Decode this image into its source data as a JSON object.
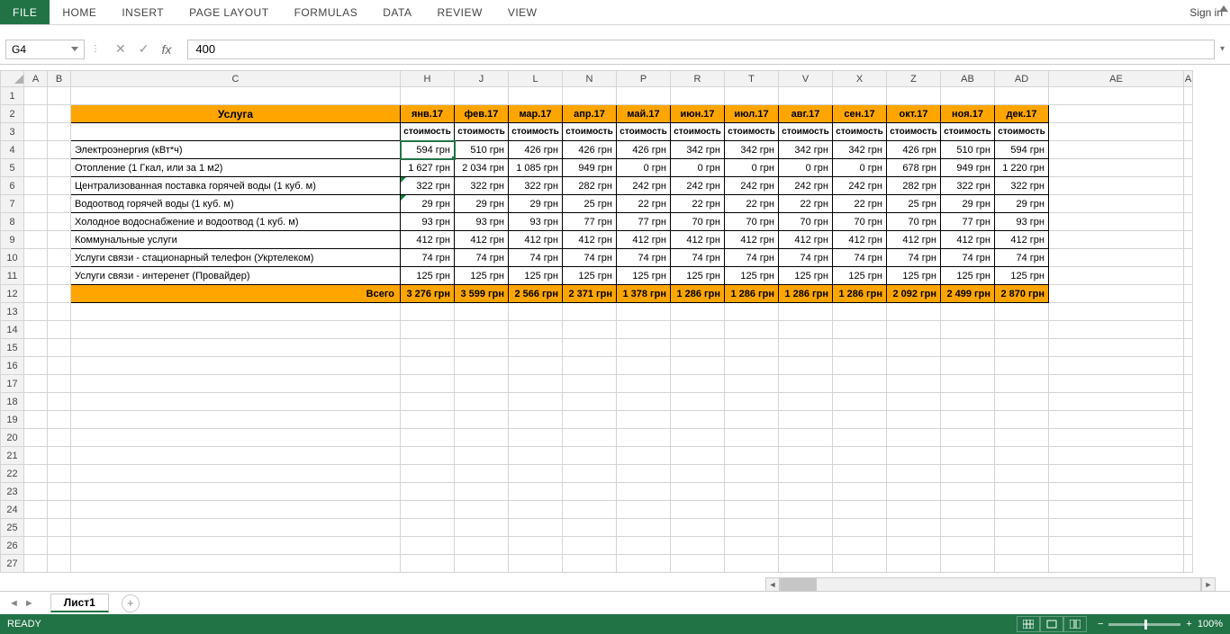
{
  "ribbon": {
    "file": "FILE",
    "tabs": [
      "HOME",
      "INSERT",
      "PAGE LAYOUT",
      "FORMULAS",
      "DATA",
      "REVIEW",
      "VIEW"
    ],
    "signin": "Sign in"
  },
  "fx": {
    "namebox": "G4",
    "formula": "400"
  },
  "columns": [
    "A",
    "B",
    "C",
    "H",
    "J",
    "L",
    "N",
    "P",
    "R",
    "T",
    "V",
    "X",
    "Z",
    "AB",
    "AD",
    "AE",
    "A"
  ],
  "table": {
    "service_header": "Услуга",
    "months": [
      "янв.17",
      "фев.17",
      "мар.17",
      "апр.17",
      "май.17",
      "июн.17",
      "июл.17",
      "авг.17",
      "сен.17",
      "окт.17",
      "ноя.17",
      "дек.17"
    ],
    "subheader": "стоимость",
    "rows": [
      {
        "name": "Электроэнергия (кВт*ч)",
        "vals": [
          "594 грн",
          "510 грн",
          "426 грн",
          "426 грн",
          "426 грн",
          "342 грн",
          "342 грн",
          "342 грн",
          "342 грн",
          "426 грн",
          "510 грн",
          "594 грн"
        ]
      },
      {
        "name": "Отопление (1 Гкал, или за 1 м2)",
        "vals": [
          "1 627 грн",
          "2 034 грн",
          "1 085 грн",
          "949 грн",
          "0 грн",
          "0 грн",
          "0 грн",
          "0 грн",
          "0 грн",
          "678 грн",
          "949 грн",
          "1 220 грн"
        ]
      },
      {
        "name": "Централизованная поставка горячей воды (1 куб. м)",
        "vals": [
          "322 грн",
          "322 грн",
          "322 грн",
          "282 грн",
          "242 грн",
          "242 грн",
          "242 грн",
          "242 грн",
          "242 грн",
          "282 грн",
          "322 грн",
          "322 грн"
        ]
      },
      {
        "name": "Водоотвод горячей воды (1 куб. м)",
        "vals": [
          "29 грн",
          "29 грн",
          "29 грн",
          "25 грн",
          "22 грн",
          "22 грн",
          "22 грн",
          "22 грн",
          "22 грн",
          "25 грн",
          "29 грн",
          "29 грн"
        ]
      },
      {
        "name": "Холодное водоснабжение и водоотвод (1 куб. м)",
        "vals": [
          "93 грн",
          "93 грн",
          "93 грн",
          "77 грн",
          "77 грн",
          "70 грн",
          "70 грн",
          "70 грн",
          "70 грн",
          "70 грн",
          "77 грн",
          "93 грн"
        ]
      },
      {
        "name": "Коммунальные услуги",
        "vals": [
          "412 грн",
          "412 грн",
          "412 грн",
          "412 грн",
          "412 грн",
          "412 грн",
          "412 грн",
          "412 грн",
          "412 грн",
          "412 грн",
          "412 грн",
          "412 грн"
        ]
      },
      {
        "name": "Услуги связи - стационарный телефон (Укртелеком)",
        "vals": [
          "74 грн",
          "74 грн",
          "74 грн",
          "74 грн",
          "74 грн",
          "74 грн",
          "74 грн",
          "74 грн",
          "74 грн",
          "74 грн",
          "74 грн",
          "74 грн"
        ]
      },
      {
        "name": "Услуги связи - интеренет (Провайдер)",
        "vals": [
          "125 грн",
          "125 грн",
          "125 грн",
          "125 грн",
          "125 грн",
          "125 грн",
          "125 грн",
          "125 грн",
          "125 грн",
          "125 грн",
          "125 грн",
          "125 грн"
        ]
      }
    ],
    "total_label": "Всего",
    "totals": [
      "3 276 грн",
      "3 599 грн",
      "2 566 грн",
      "2 371 грн",
      "1 378 грн",
      "1 286 грн",
      "1 286 грн",
      "1 286 грн",
      "1 286 грн",
      "2 092 грн",
      "2 499 грн",
      "2 870 грн"
    ]
  },
  "sheettab": "Лист1",
  "status": {
    "ready": "READY",
    "zoom": "100%"
  },
  "active_cell_tri": [
    2,
    0
  ],
  "selected_row": 4
}
